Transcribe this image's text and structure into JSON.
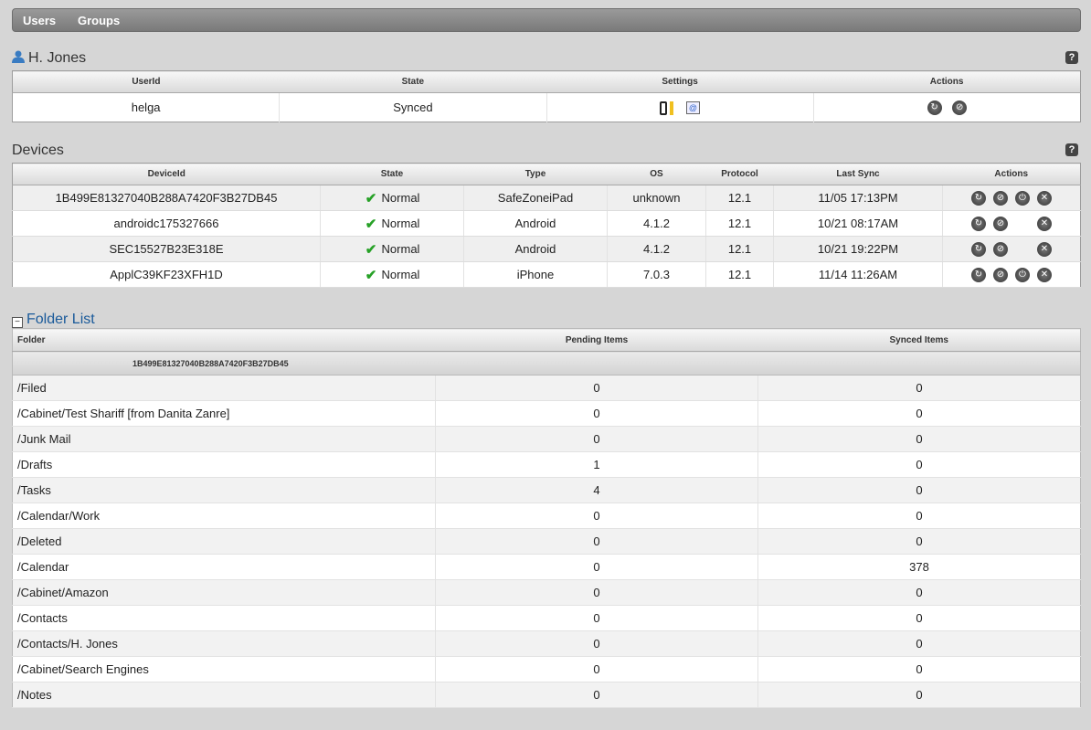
{
  "nav": {
    "tabs": [
      "Users",
      "Groups"
    ]
  },
  "user": {
    "name": "H. Jones",
    "headers": [
      "UserId",
      "State",
      "Settings",
      "Actions"
    ],
    "userid": "helga",
    "state": "Synced"
  },
  "devices": {
    "title": "Devices",
    "headers": [
      "DeviceId",
      "State",
      "Type",
      "OS",
      "Protocol",
      "Last Sync",
      "Actions"
    ],
    "rows": [
      {
        "id": "1B499E81327040B288A7420F3B27DB45",
        "state": "Normal",
        "type": "SafeZoneiPad",
        "os": "unknown",
        "protocol": "12.1",
        "last": "11/05 17:13PM",
        "actions": [
          "refresh",
          "block",
          "power",
          "delete"
        ]
      },
      {
        "id": "androidc175327666",
        "state": "Normal",
        "type": "Android",
        "os": "4.1.2",
        "protocol": "12.1",
        "last": "10/21 08:17AM",
        "actions": [
          "refresh",
          "block",
          "",
          "delete"
        ]
      },
      {
        "id": "SEC15527B23E318E",
        "state": "Normal",
        "type": "Android",
        "os": "4.1.2",
        "protocol": "12.1",
        "last": "10/21 19:22PM",
        "actions": [
          "refresh",
          "block",
          "",
          "delete"
        ]
      },
      {
        "id": "ApplC39KF23XFH1D",
        "state": "Normal",
        "type": "iPhone",
        "os": "7.0.3",
        "protocol": "12.1",
        "last": "11/14 11:26AM",
        "actions": [
          "refresh",
          "block",
          "power",
          "delete"
        ]
      }
    ]
  },
  "folders": {
    "title": "Folder List",
    "headers": [
      "Folder",
      "Pending Items",
      "Synced Items"
    ],
    "group": "1B499E81327040B288A7420F3B27DB45",
    "rows": [
      [
        "/Filed",
        "0",
        "0"
      ],
      [
        "/Cabinet/Test Shariff [from Danita Zanre]",
        "0",
        "0"
      ],
      [
        "/Junk Mail",
        "0",
        "0"
      ],
      [
        "/Drafts",
        "1",
        "0"
      ],
      [
        "/Tasks",
        "4",
        "0"
      ],
      [
        "/Calendar/Work",
        "0",
        "0"
      ],
      [
        "/Deleted",
        "0",
        "0"
      ],
      [
        "/Calendar",
        "0",
        "378"
      ],
      [
        "/Cabinet/Amazon",
        "0",
        "0"
      ],
      [
        "/Contacts",
        "0",
        "0"
      ],
      [
        "/Contacts/H. Jones",
        "0",
        "0"
      ],
      [
        "/Cabinet/Search Engines",
        "0",
        "0"
      ],
      [
        "/Notes",
        "0",
        "0"
      ]
    ]
  },
  "colors": {
    "accent": "#1a5a9a",
    "check": "#27a127"
  }
}
